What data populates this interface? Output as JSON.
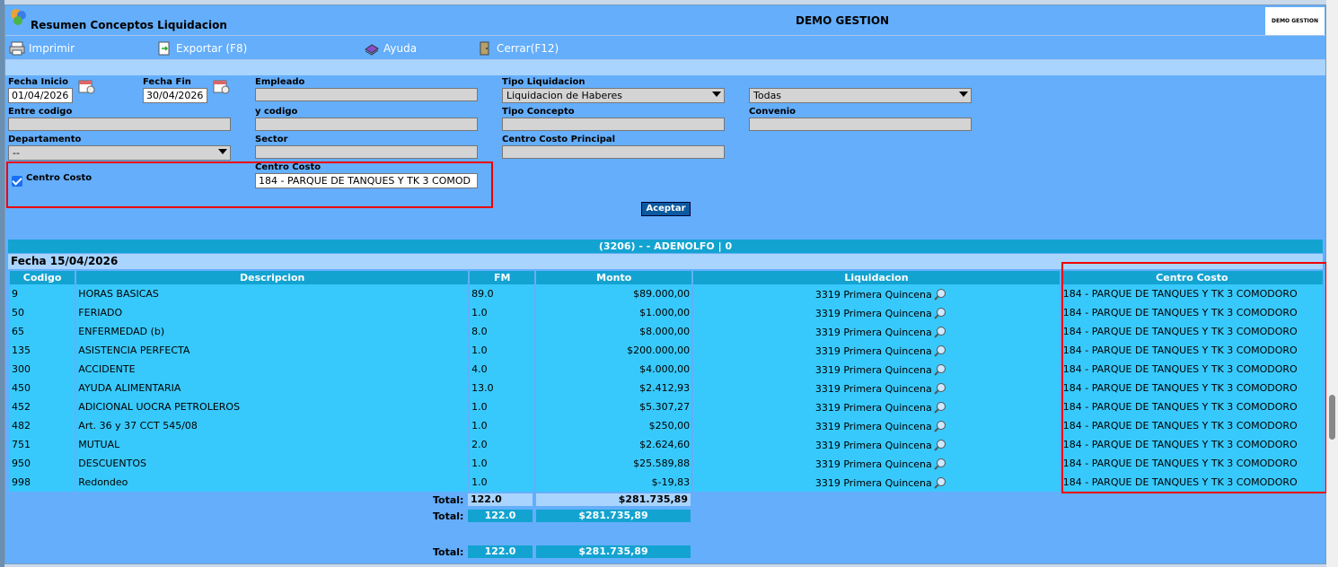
{
  "window": {
    "title": "Resumen Conceptos Liquidacion",
    "company": "DEMO GESTION",
    "brand": "DEMO GESTION"
  },
  "toolbar": {
    "print": "Imprimir",
    "export": "Exportar (F8)",
    "help": "Ayuda",
    "close": "Cerrar(F12)"
  },
  "filters": {
    "fecha_inicio_label": "Fecha Inicio",
    "fecha_inicio": "01/04/2026",
    "fecha_fin_label": "Fecha Fin",
    "fecha_fin": "30/04/2026",
    "empleado_label": "Empleado",
    "empleado": "",
    "tipo_liq_label": "Tipo Liquidacion",
    "tipo_liq": "Liquidacion de Haberes",
    "todas": "Todas",
    "entre_codigo_label": "Entre codigo",
    "y_codigo_label": "y codigo",
    "tipo_concepto_label": "Tipo Concepto",
    "convenio_label": "Convenio",
    "departamento_label": "Departamento",
    "departamento": "--",
    "sector_label": "Sector",
    "centro_costo_principal_label": "Centro Costo Principal",
    "centro_costo_chk_label": "Centro Costo",
    "centro_costo_label": "Centro Costo",
    "centro_costo": "184 - PARQUE DE TANQUES Y TK 3 COMOD",
    "aceptar": "Aceptar"
  },
  "employee_header": "(3206) - - ADENOLFO | 0",
  "fecha_line": "Fecha 15/04/2026",
  "columns": [
    "Codigo",
    "Descripcion",
    "FM",
    "Monto",
    "Liquidacion",
    "Centro Costo"
  ],
  "rows": [
    {
      "codigo": "9",
      "desc": "HORAS BASICAS",
      "fm": "89.0",
      "monto": "$89.000,00",
      "liq": "3319 Primera Quincena",
      "cc": "184 - PARQUE DE TANQUES Y TK 3 COMODORO"
    },
    {
      "codigo": "50",
      "desc": "FERIADO",
      "fm": "1.0",
      "monto": "$1.000,00",
      "liq": "3319 Primera Quincena",
      "cc": "184 - PARQUE DE TANQUES Y TK 3 COMODORO"
    },
    {
      "codigo": "65",
      "desc": "ENFERMEDAD (b)",
      "fm": "8.0",
      "monto": "$8.000,00",
      "liq": "3319 Primera Quincena",
      "cc": "184 - PARQUE DE TANQUES Y TK 3 COMODORO"
    },
    {
      "codigo": "135",
      "desc": "ASISTENCIA PERFECTA",
      "fm": "1.0",
      "monto": "$200.000,00",
      "liq": "3319 Primera Quincena",
      "cc": "184 - PARQUE DE TANQUES Y TK 3 COMODORO"
    },
    {
      "codigo": "300",
      "desc": "ACCIDENTE",
      "fm": "4.0",
      "monto": "$4.000,00",
      "liq": "3319 Primera Quincena",
      "cc": "184 - PARQUE DE TANQUES Y TK 3 COMODORO"
    },
    {
      "codigo": "450",
      "desc": "AYUDA ALIMENTARIA",
      "fm": "13.0",
      "monto": "$2.412,93",
      "liq": "3319 Primera Quincena",
      "cc": "184 - PARQUE DE TANQUES Y TK 3 COMODORO"
    },
    {
      "codigo": "452",
      "desc": "ADICIONAL UOCRA PETROLEROS",
      "fm": "1.0",
      "monto": "$5.307,27",
      "liq": "3319 Primera Quincena",
      "cc": "184 - PARQUE DE TANQUES Y TK 3 COMODORO"
    },
    {
      "codigo": "482",
      "desc": "Art. 36 y 37 CCT 545/08",
      "fm": "1.0",
      "monto": "$250,00",
      "liq": "3319 Primera Quincena",
      "cc": "184 - PARQUE DE TANQUES Y TK 3 COMODORO"
    },
    {
      "codigo": "751",
      "desc": "MUTUAL",
      "fm": "2.0",
      "monto": "$2.624,60",
      "liq": "3319 Primera Quincena",
      "cc": "184 - PARQUE DE TANQUES Y TK 3 COMODORO"
    },
    {
      "codigo": "950",
      "desc": "DESCUENTOS",
      "fm": "1.0",
      "monto": "$25.589,88",
      "liq": "3319 Primera Quincena",
      "cc": "184 - PARQUE DE TANQUES Y TK 3 COMODORO"
    },
    {
      "codigo": "998",
      "desc": "Redondeo",
      "fm": "1.0",
      "monto": "$-19,83",
      "liq": "3319 Primera Quincena",
      "cc": "184 - PARQUE DE TANQUES Y TK 3 COMODORO"
    }
  ],
  "totals": [
    {
      "label": "Total:",
      "fm": "122.0",
      "monto": "$281.735,89"
    },
    {
      "label": "Total:",
      "fm": "122.0",
      "monto": "$281.735,89"
    },
    {
      "label": "Total:",
      "fm": "122.0",
      "monto": "$281.735,89"
    }
  ]
}
